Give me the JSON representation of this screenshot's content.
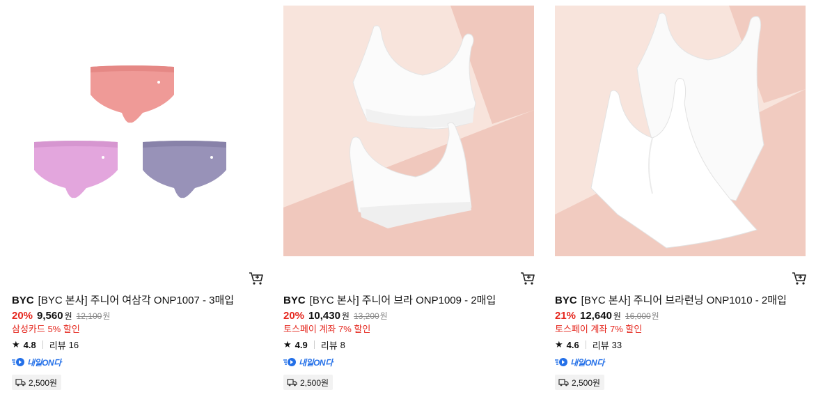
{
  "products": [
    {
      "image_desc_icon": "kids-briefs-3pack-image",
      "brand": "BYC",
      "title": "[BYC 본사] 주니어 여삼각 ONP1007 - 3매입",
      "discount": "20%",
      "price": "9,560",
      "price_unit": "원",
      "original_price": "12,100",
      "original_unit": "원",
      "promo": "삼성카드 5% 할인",
      "rating": "4.8",
      "review_label": "리뷰",
      "review_count": "16",
      "delivery_badge": "내일ON다",
      "shipping": "2,500원"
    },
    {
      "image_desc_icon": "junior-bra-2pack-image",
      "brand": "BYC",
      "title": "[BYC 본사] 주니어 브라 ONP1009 - 2매입",
      "discount": "20%",
      "price": "10,430",
      "price_unit": "원",
      "original_price": "13,200",
      "original_unit": "원",
      "promo": "토스페이 계좌 7% 할인",
      "rating": "4.9",
      "review_label": "리뷰",
      "review_count": "8",
      "delivery_badge": "내일ON다",
      "shipping": "2,500원"
    },
    {
      "image_desc_icon": "junior-camisole-2pack-image",
      "brand": "BYC",
      "title": "[BYC 본사] 주니어 브라런닝 ONP1010 - 2매입",
      "discount": "21%",
      "price": "12,640",
      "price_unit": "원",
      "original_price": "16,000",
      "original_unit": "원",
      "promo": "토스페이 계좌 7% 할인",
      "rating": "4.6",
      "review_label": "리뷰",
      "review_count": "33",
      "delivery_badge": "내일ON다",
      "shipping": "2,500원"
    }
  ],
  "colors": {
    "discount_red": "#e5281f",
    "naeil_blue": "#2470e8",
    "panty_pink": "#ef9a97",
    "panty_lilac": "#e3a6dd",
    "panty_lavender": "#9892b8",
    "bg_peach": "#f5d9d0"
  },
  "icons": {
    "cart": "cart-icon",
    "star": "star-icon",
    "truck": "truck-icon",
    "naeil": "fast-delivery-icon"
  }
}
